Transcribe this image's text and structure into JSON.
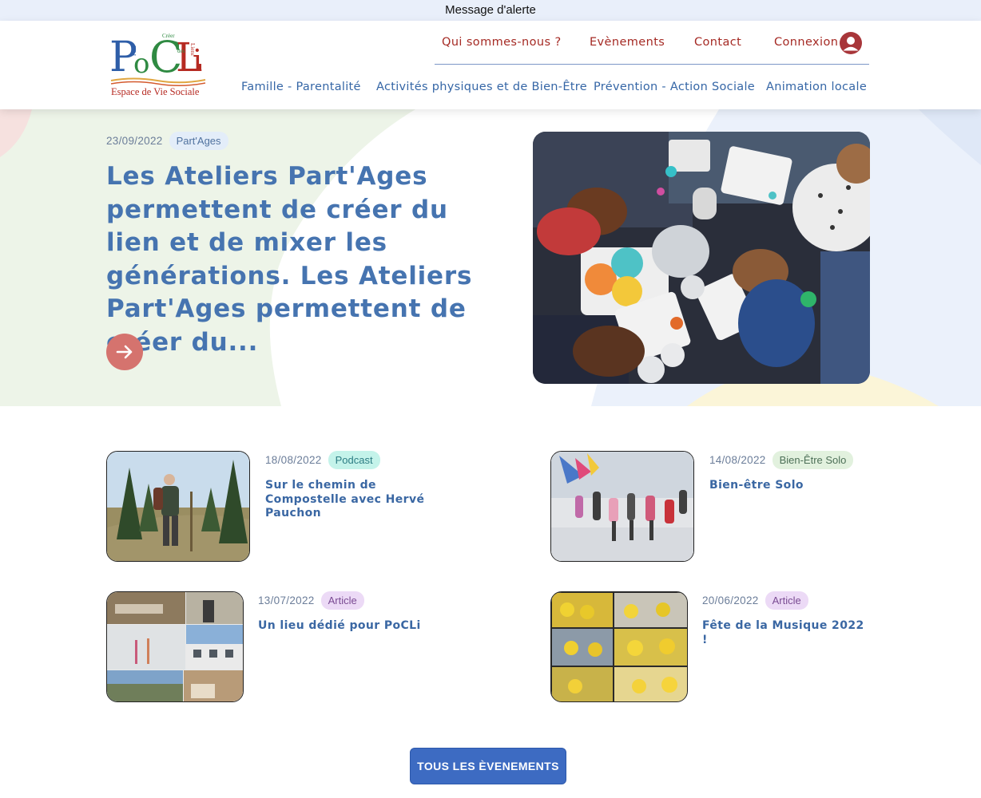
{
  "alert": {
    "text": "Message d'alerte"
  },
  "logo": {
    "letters": "PoCLi",
    "tagline_words": [
      "Pour",
      "Créer",
      "des",
      "Liens"
    ],
    "subtitle": "Espace de Vie Sociale"
  },
  "top_nav": {
    "items": [
      "Qui sommes-nous ?",
      "Evènements",
      "Contact",
      "Connexion"
    ]
  },
  "main_nav": {
    "items": [
      "Famille - Parentalité",
      "Activités physiques et de Bien-Être",
      "Prévention - Action Sociale",
      "Animation locale"
    ]
  },
  "hero": {
    "date": "23/09/2022",
    "tag": "Part'Ages",
    "title": "Les Ateliers Part'Ages permettent de créer du lien et de mixer les générations. Les Ateliers Part'Ages permettent de créer du..."
  },
  "cards": [
    {
      "date": "18/08/2022",
      "tag": "Podcast",
      "title": "Sur le chemin de Compostelle avec Hervé Pauchon"
    },
    {
      "date": "14/08/2022",
      "tag": "Bien-Être Solo",
      "title": "Bien-être Solo"
    },
    {
      "date": "13/07/2022",
      "tag": "Article",
      "title": "Un lieu dédié pour PoCLi"
    },
    {
      "date": "20/06/2022",
      "tag": "Article",
      "title": "Fête de la Musique 2022 !"
    }
  ],
  "cta": {
    "label": "TOUS LES ÈVENEMENTS"
  },
  "icons": {
    "account": "user-circle-icon",
    "hero_arrow": "arrow-right-icon"
  },
  "colors": {
    "brand_red": "#a52a24",
    "brand_blue": "#3566a6",
    "hero_title": "#4674b0",
    "arrow_button": "#d5736e",
    "cta_button": "#3d6bc2",
    "alert_bg": "#e9effa"
  }
}
